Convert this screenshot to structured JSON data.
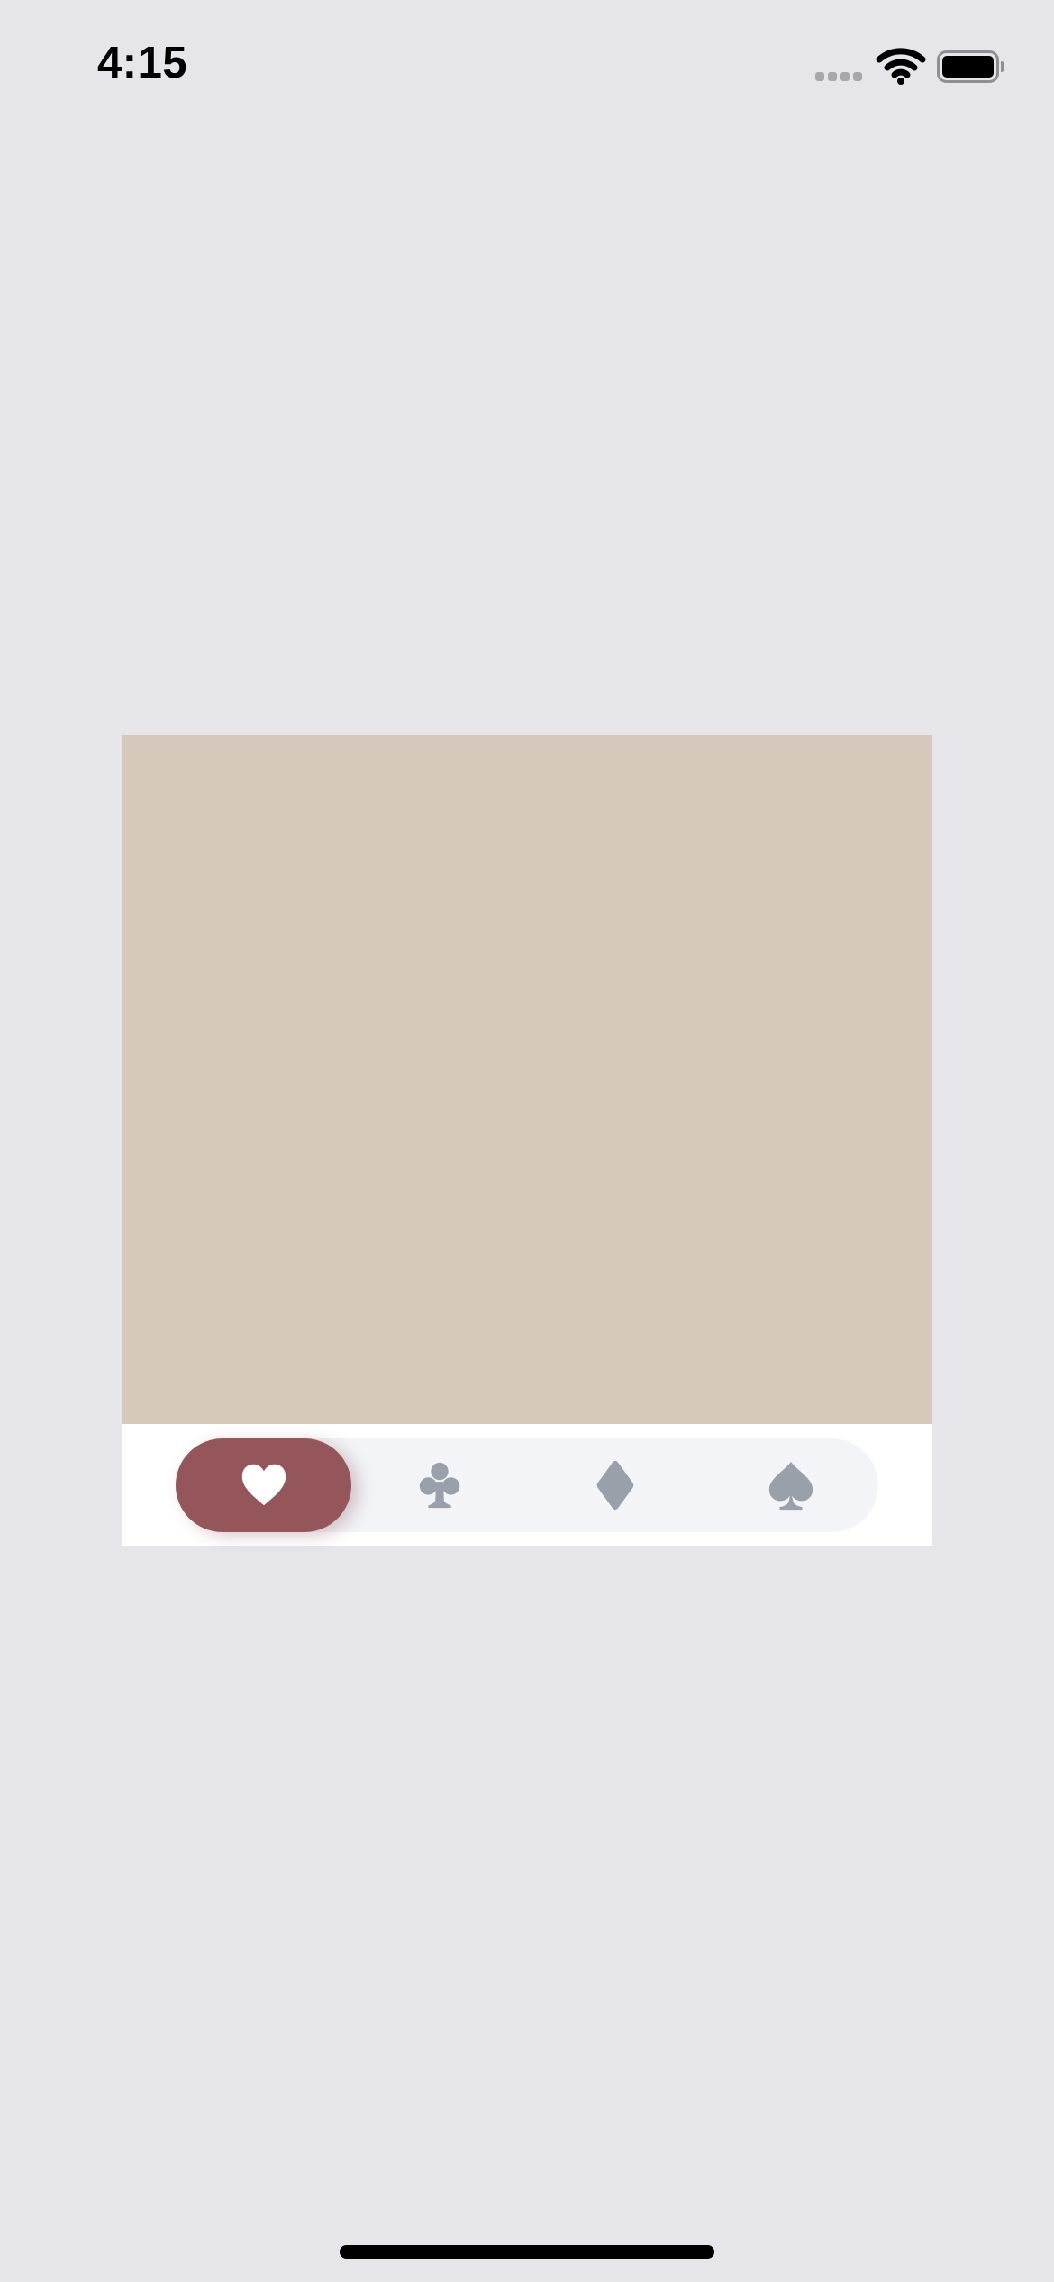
{
  "status_bar": {
    "time": "4:15",
    "icons": [
      "cellular-signal-icon",
      "wifi-icon",
      "battery-icon"
    ]
  },
  "card": {
    "image_color": "#d6c9bc",
    "background_color": "#ffffff"
  },
  "tab_bar": {
    "track_color": "#f2f4f8",
    "accent_color": "#94555b",
    "inactive_icon_color": "#9aa0a9",
    "active_icon_color": "#ffffff",
    "selected_index": 0,
    "tabs": [
      {
        "icon": "heart-icon",
        "selected": true
      },
      {
        "icon": "club-icon",
        "selected": false
      },
      {
        "icon": "diamond-icon",
        "selected": false
      },
      {
        "icon": "spade-icon",
        "selected": false
      }
    ]
  }
}
